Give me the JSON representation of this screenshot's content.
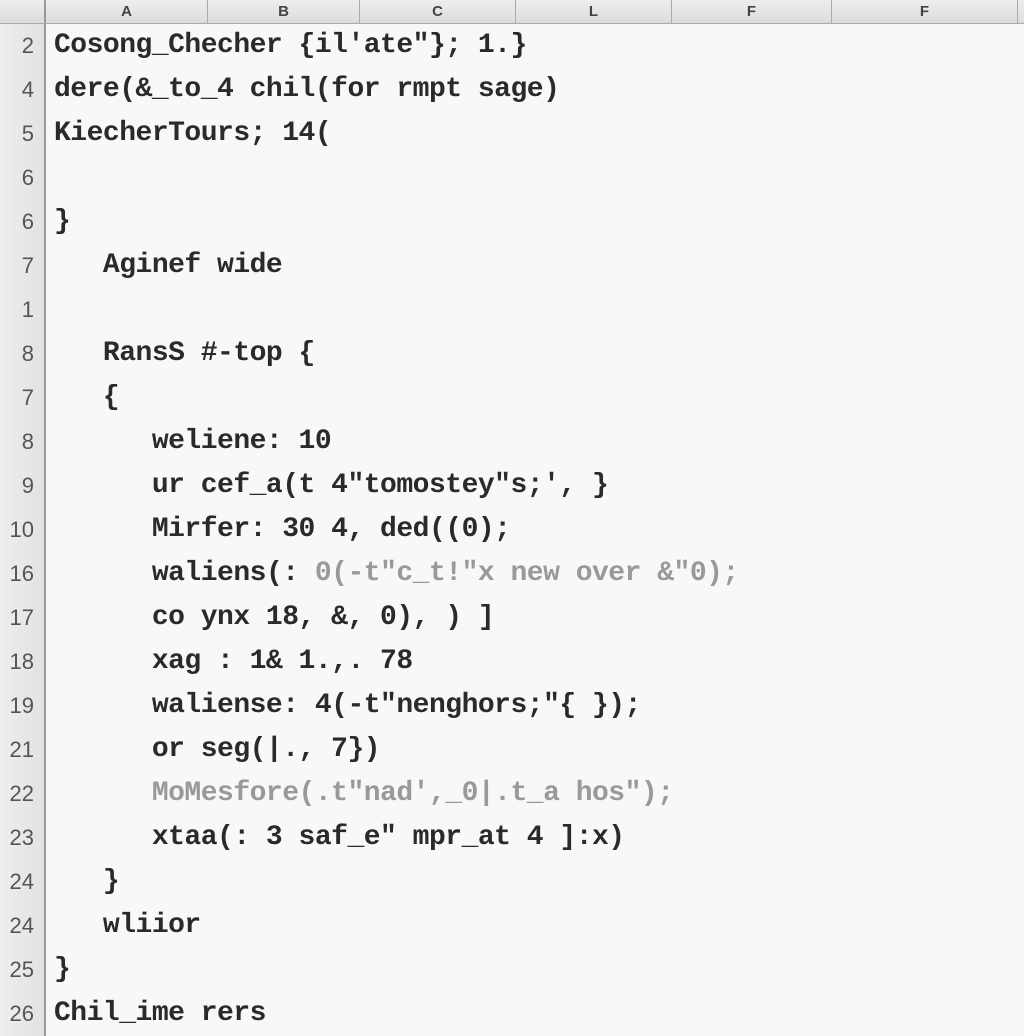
{
  "columns": [
    {
      "label": "A",
      "width": 162
    },
    {
      "label": "B",
      "width": 152
    },
    {
      "label": "C",
      "width": 156
    },
    {
      "label": "L",
      "width": 156
    },
    {
      "label": "F",
      "width": 160
    },
    {
      "label": "F",
      "width": 186
    }
  ],
  "rows": [
    {
      "num": "2",
      "indent": 0,
      "text": "Cosong_Checher {il'ate\"}; 1.}"
    },
    {
      "num": "4",
      "indent": 0,
      "text": "dere(&_to_4 chil(for rmpt sage)"
    },
    {
      "num": "5",
      "indent": 0,
      "text": "KiecherTours; 14("
    },
    {
      "num": "6",
      "indent": 0,
      "text": ""
    },
    {
      "num": "6",
      "indent": 0,
      "text": "}"
    },
    {
      "num": "7",
      "indent": 1,
      "text": "Aginef wide"
    },
    {
      "num": "1",
      "indent": 0,
      "text": ""
    },
    {
      "num": "8",
      "indent": 1,
      "text": "RansS #-top {"
    },
    {
      "num": "7",
      "indent": 1,
      "text": "{"
    },
    {
      "num": "8",
      "indent": 2,
      "text": "weliene: 10"
    },
    {
      "num": "9",
      "indent": 2,
      "text": "ur cef_a(t 4\"tomostey\"s;', }"
    },
    {
      "num": "10",
      "indent": 2,
      "text": "Mirfer: 30 4, ded((0);"
    },
    {
      "num": "16",
      "indent": 2,
      "mixed": true,
      "parts": [
        {
          "t": "waliens(: ",
          "fade": false
        },
        {
          "t": "0(-t\"c_t!\"x new over &\"0);",
          "fade": true
        }
      ]
    },
    {
      "num": "17",
      "indent": 2,
      "text": "co ynx 18, &, 0), ) ]"
    },
    {
      "num": "18",
      "indent": 2,
      "text": "xag : 1& 1.,. 78"
    },
    {
      "num": "19",
      "indent": 2,
      "text": "waliense: 4(-t\"nenghors;\"{ });"
    },
    {
      "num": "21",
      "indent": 2,
      "text": "or seg(|., 7})"
    },
    {
      "num": "22",
      "indent": 2,
      "faded": true,
      "text": "MoMesfore(.t\"nad',_0|.t_a hos\");"
    },
    {
      "num": "23",
      "indent": 2,
      "text": "xtaa(: 3 saf_e\" mpr_at 4 ]:x)"
    },
    {
      "num": "24",
      "indent": 1,
      "text": "}"
    },
    {
      "num": "24",
      "indent": 1,
      "text": "wliior"
    },
    {
      "num": "25",
      "indent": 0,
      "text": "}"
    },
    {
      "num": "26",
      "indent": 0,
      "text": "Chil_ime rers"
    }
  ]
}
